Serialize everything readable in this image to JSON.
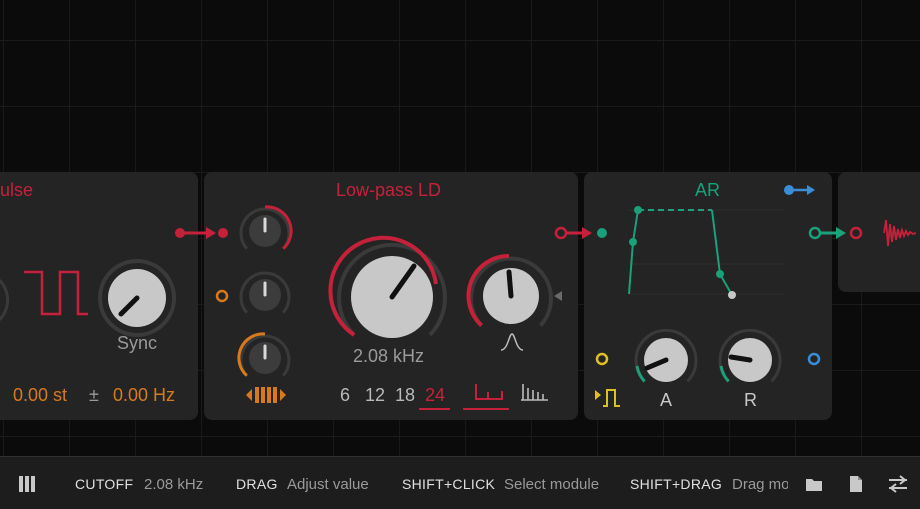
{
  "modules": {
    "pulse": {
      "title": "ulse",
      "sync_label": "Sync",
      "pitch_value": "0.00 st",
      "pm_symbol": "±",
      "freq_value": "0.00 Hz"
    },
    "lowpass": {
      "title": "Low-pass LD",
      "cutoff_value": "2.08 kHz",
      "slopes": [
        "6",
        "12",
        "18",
        "24"
      ],
      "active_slope": "24"
    },
    "ar": {
      "title": "AR",
      "attack_label": "A",
      "release_label": "R"
    }
  },
  "colors": {
    "pulse": "#c6213a",
    "lowpass": "#c6213a",
    "ar": "#1aa07a",
    "accent": "#d77a1e",
    "gate": "#e0c020",
    "blue": "#3a8ed6"
  },
  "status": {
    "param_key": "CUTOFF",
    "param_value": "2.08 kHz",
    "drag_key": "DRAG",
    "drag_value": "Adjust value",
    "shift_click_key": "SHIFT+CLICK",
    "shift_click_value": "Select module",
    "shift_drag_key": "SHIFT+DRAG",
    "shift_drag_value": "Drag mo"
  },
  "icons": [
    "panels-icon",
    "folder-icon",
    "file-icon",
    "settings-icon"
  ]
}
